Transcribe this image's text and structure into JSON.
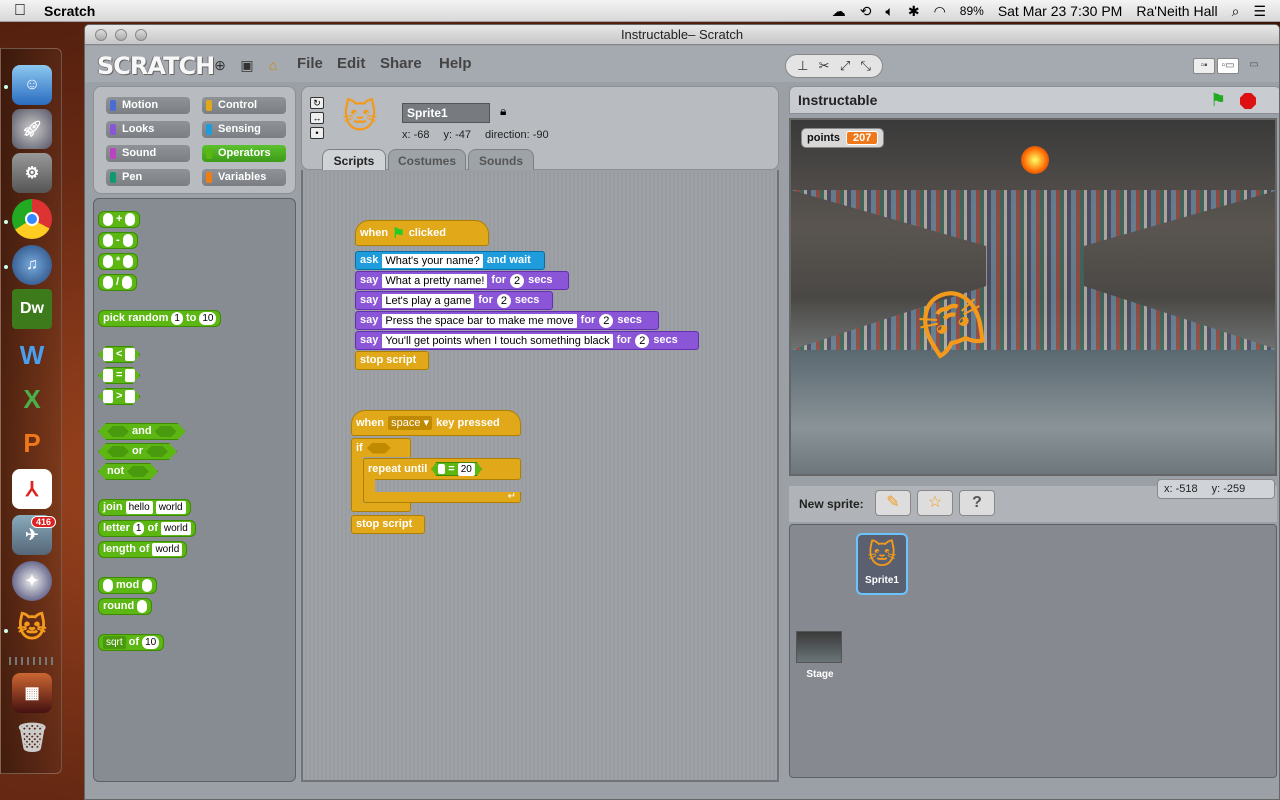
{
  "mac": {
    "app_name": "Scratch",
    "battery": "89%",
    "clock": "Sat Mar 23  7:30 PM",
    "user": "Ra'Neith Hall"
  },
  "dock": {
    "mail_badge": "416",
    "icons": [
      "finder-icon",
      "launchpad-icon",
      "system-preferences-icon",
      "chrome-icon",
      "itunes-icon",
      "dreamweaver-icon",
      "word-icon",
      "excel-icon",
      "powerpoint-icon",
      "acrobat-icon",
      "mail-icon",
      "safari-icon",
      "scratch-icon",
      "photo-icon",
      "trash-icon"
    ]
  },
  "window": {
    "title": "Instructable– Scratch"
  },
  "scratch": {
    "logo": "SCRATCH",
    "menus": [
      "File",
      "Edit",
      "Share",
      "Help"
    ],
    "categories": [
      {
        "label": "Motion",
        "color": "#4a6cd4"
      },
      {
        "label": "Control",
        "color": "#e1a91a"
      },
      {
        "label": "Looks",
        "color": "#8a55d7"
      },
      {
        "label": "Sensing",
        "color": "#1e9cdb"
      },
      {
        "label": "Sound",
        "color": "#bb42c3"
      },
      {
        "label": "Operators",
        "color": "#5cb712"
      },
      {
        "label": "Pen",
        "color": "#0e9a6c"
      },
      {
        "label": "Variables",
        "color": "#ee7d16"
      }
    ],
    "palette": {
      "plus": "+",
      "minus": "-",
      "times": "*",
      "divide": "/",
      "pick_random": "pick random",
      "pick_from": "1",
      "pick_to_word": "to",
      "pick_to": "10",
      "lt": "<",
      "eq": "=",
      "gt": ">",
      "and": "and",
      "or": "or",
      "not": "not",
      "join": "join",
      "join_a": "hello",
      "join_b": "world",
      "letter": "letter",
      "letter_n": "1",
      "letter_of": "of",
      "letter_word": "world",
      "length_of": "length of",
      "length_word": "world",
      "mod": "mod",
      "round": "round",
      "sqrt": "sqrt",
      "sqrt_of": "of",
      "sqrt_val": "10"
    },
    "sprite": {
      "name": "Sprite1",
      "x": "x: -68",
      "y": "y: -47",
      "direction": "direction: -90"
    },
    "tabs": [
      "Scripts",
      "Costumes",
      "Sounds"
    ],
    "script1": {
      "when": "when",
      "clicked": "clicked",
      "ask": "ask",
      "ask_text": "What's your name?",
      "and_wait": "and wait",
      "say_word": "say",
      "for_word": "for",
      "secs": "secs",
      "says": [
        {
          "text": "What a pretty name!",
          "secs": "2"
        },
        {
          "text": "Let's play a game",
          "secs": "2"
        },
        {
          "text": "Press the space bar to make me move",
          "secs": "2"
        },
        {
          "text": "You'll get points when I touch something black",
          "secs": "2"
        }
      ],
      "stop": "stop script"
    },
    "script2": {
      "when": "when",
      "key": "space",
      "key_pressed": "key pressed",
      "if_word": "if",
      "repeat_until": "repeat until",
      "eq": "=",
      "eq_val": "20",
      "stop": "stop script"
    },
    "stage": {
      "title": "Instructable",
      "monitor_label": "points",
      "monitor_value": "207",
      "mouse_x": "x: -518",
      "mouse_y": "y: -259"
    },
    "new_sprite_label": "New sprite:",
    "sprite_list": {
      "sprite_label": "Sprite1",
      "stage_label": "Stage"
    }
  }
}
